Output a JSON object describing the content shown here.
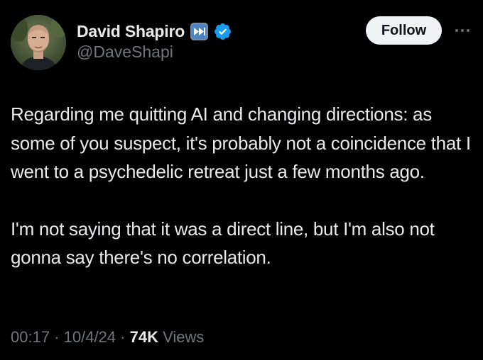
{
  "author": {
    "display_name": "David Shapiro",
    "handle": "@DaveShapi",
    "badges": [
      "automated-fast-forward-icon",
      "verified-badge-icon"
    ]
  },
  "actions": {
    "follow_label": "Follow",
    "more_icon": "more-horizontal-icon"
  },
  "tweet": {
    "paragraphs": [
      "Regarding me quitting AI and changing directions: as some of you suspect, it's probably not a coincidence that I went to a psychedelic retreat just a few months ago.",
      "I'm not saying that it was a direct line, but I'm also not gonna say there's no correlation."
    ]
  },
  "meta": {
    "time": "00:17",
    "separator": "·",
    "date": "10/4/24",
    "views_count": "74K",
    "views_label": "Views"
  },
  "colors": {
    "background": "#000000",
    "text_primary": "#e7e9ea",
    "text_secondary": "#71767b",
    "verified_blue": "#1d9bf0",
    "follow_bg": "#eff3f4"
  }
}
